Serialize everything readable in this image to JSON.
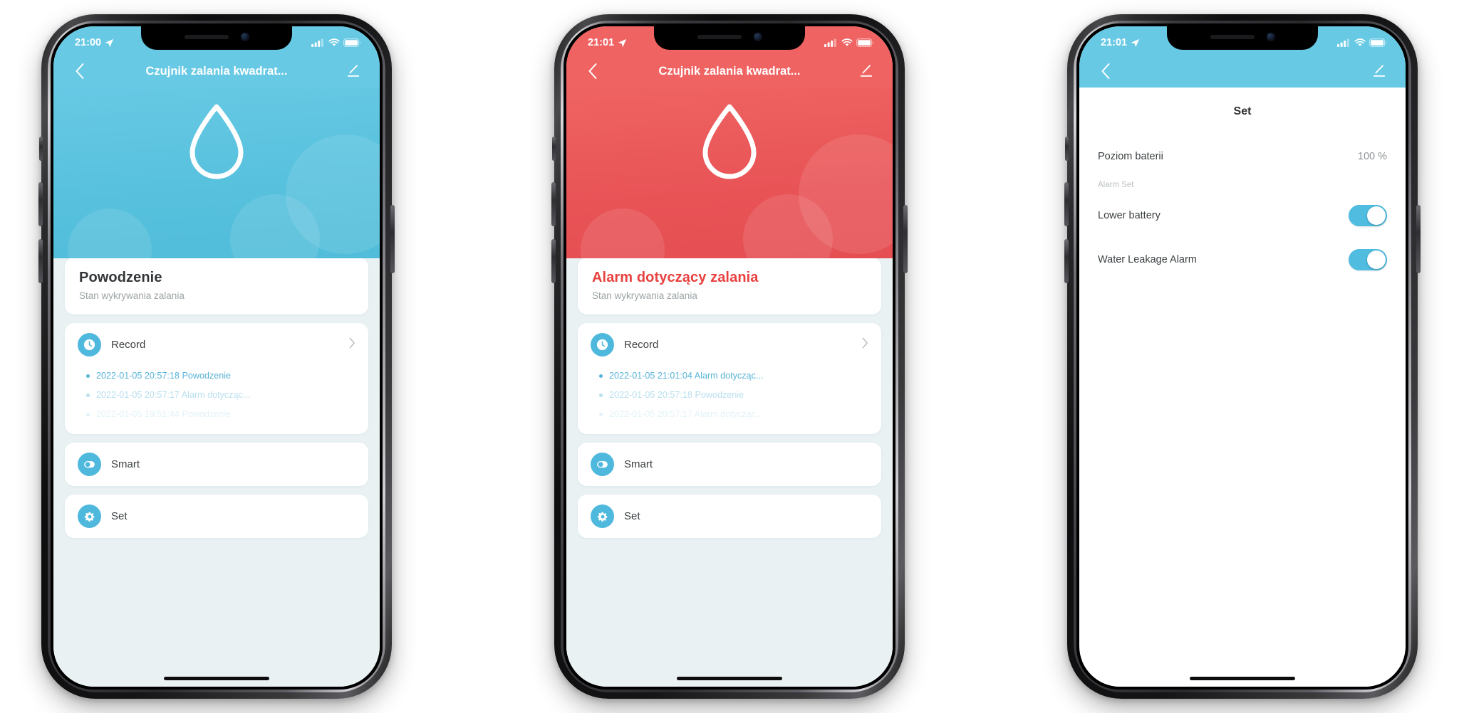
{
  "app": {
    "blue": "#5BC3E0",
    "red": "#E85356",
    "icon_blue": "#4FB8DD",
    "alarm_text_color": "#E8413F"
  },
  "phones": [
    {
      "id": "phone-normal",
      "status_bar": {
        "time": "21:00",
        "location_icon": "location-arrow-icon",
        "signal_icon": "cellular-signal-icon",
        "wifi_icon": "wifi-icon",
        "battery_icon": "battery-icon"
      },
      "nav": {
        "back_icon": "chevron-left-icon",
        "title": "Czujnik zalania kwadrat...",
        "edit_icon": "pencil-edit-icon"
      },
      "hero": {
        "icon": "water-drop-icon",
        "theme": "blue"
      },
      "state_card": {
        "title": "Powodzenie",
        "subtitle": "Stan wykrywania zalania",
        "is_alarm": false
      },
      "record": {
        "icon": "clock-icon",
        "label": "Record",
        "chevron_icon": "chevron-right-icon",
        "entries": [
          "2022-01-05 20:57:18 Powodzenie",
          "2022-01-05 20:57:17 Alarm dotycząc...",
          "2022-01-05 19:51:44 Powodzenie"
        ]
      },
      "smart": {
        "icon": "toggle-switch-icon",
        "label": "Smart"
      },
      "set": {
        "icon": "gear-icon",
        "label": "Set"
      }
    },
    {
      "id": "phone-alarm",
      "status_bar": {
        "time": "21:01",
        "location_icon": "location-arrow-icon",
        "signal_icon": "cellular-signal-icon",
        "wifi_icon": "wifi-icon",
        "battery_icon": "battery-icon"
      },
      "nav": {
        "back_icon": "chevron-left-icon",
        "title": "Czujnik zalania kwadrat...",
        "edit_icon": "pencil-edit-icon"
      },
      "hero": {
        "icon": "water-drop-icon",
        "theme": "red"
      },
      "state_card": {
        "title": "Alarm dotyczący zalania",
        "subtitle": "Stan wykrywania zalania",
        "is_alarm": true
      },
      "record": {
        "icon": "clock-icon",
        "label": "Record",
        "chevron_icon": "chevron-right-icon",
        "entries": [
          "2022-01-05 21:01:04 Alarm dotycząc...",
          "2022-01-05 20:57:18 Powodzenie",
          "2022-01-05 20:57:17 Alarm dotycząc..."
        ]
      },
      "smart": {
        "icon": "toggle-switch-icon",
        "label": "Smart"
      },
      "set": {
        "icon": "gear-icon",
        "label": "Set"
      }
    },
    {
      "id": "phone-settings",
      "status_bar": {
        "time": "21:01",
        "location_icon": "location-arrow-icon",
        "signal_icon": "cellular-signal-icon",
        "wifi_icon": "wifi-icon",
        "battery_icon": "battery-icon"
      },
      "nav": {
        "back_icon": "chevron-left-icon",
        "title": "",
        "edit_icon": "pencil-edit-icon"
      },
      "settings": {
        "title": "Set",
        "battery_row": {
          "label": "Poziom baterii",
          "value": "100 %"
        },
        "group_label": "Alarm Set",
        "toggles": [
          {
            "label": "Lower battery",
            "on": true
          },
          {
            "label": "Water Leakage Alarm",
            "on": true
          }
        ]
      }
    }
  ]
}
